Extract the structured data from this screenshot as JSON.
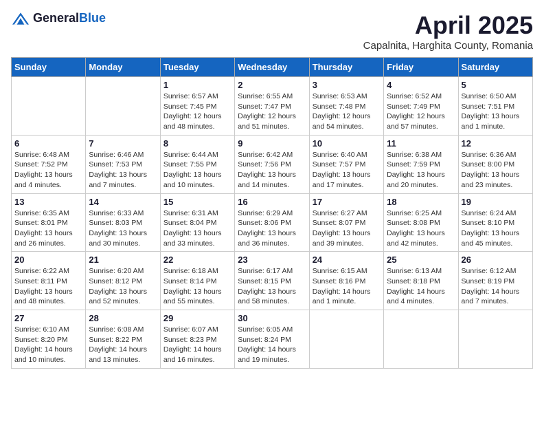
{
  "header": {
    "logo_general": "General",
    "logo_blue": "Blue",
    "title": "April 2025",
    "subtitle": "Capalnita, Harghita County, Romania"
  },
  "days_of_week": [
    "Sunday",
    "Monday",
    "Tuesday",
    "Wednesday",
    "Thursday",
    "Friday",
    "Saturday"
  ],
  "weeks": [
    [
      {
        "day": "",
        "info": ""
      },
      {
        "day": "",
        "info": ""
      },
      {
        "day": "1",
        "info": "Sunrise: 6:57 AM\nSunset: 7:45 PM\nDaylight: 12 hours and 48 minutes."
      },
      {
        "day": "2",
        "info": "Sunrise: 6:55 AM\nSunset: 7:47 PM\nDaylight: 12 hours and 51 minutes."
      },
      {
        "day": "3",
        "info": "Sunrise: 6:53 AM\nSunset: 7:48 PM\nDaylight: 12 hours and 54 minutes."
      },
      {
        "day": "4",
        "info": "Sunrise: 6:52 AM\nSunset: 7:49 PM\nDaylight: 12 hours and 57 minutes."
      },
      {
        "day": "5",
        "info": "Sunrise: 6:50 AM\nSunset: 7:51 PM\nDaylight: 13 hours and 1 minute."
      }
    ],
    [
      {
        "day": "6",
        "info": "Sunrise: 6:48 AM\nSunset: 7:52 PM\nDaylight: 13 hours and 4 minutes."
      },
      {
        "day": "7",
        "info": "Sunrise: 6:46 AM\nSunset: 7:53 PM\nDaylight: 13 hours and 7 minutes."
      },
      {
        "day": "8",
        "info": "Sunrise: 6:44 AM\nSunset: 7:55 PM\nDaylight: 13 hours and 10 minutes."
      },
      {
        "day": "9",
        "info": "Sunrise: 6:42 AM\nSunset: 7:56 PM\nDaylight: 13 hours and 14 minutes."
      },
      {
        "day": "10",
        "info": "Sunrise: 6:40 AM\nSunset: 7:57 PM\nDaylight: 13 hours and 17 minutes."
      },
      {
        "day": "11",
        "info": "Sunrise: 6:38 AM\nSunset: 7:59 PM\nDaylight: 13 hours and 20 minutes."
      },
      {
        "day": "12",
        "info": "Sunrise: 6:36 AM\nSunset: 8:00 PM\nDaylight: 13 hours and 23 minutes."
      }
    ],
    [
      {
        "day": "13",
        "info": "Sunrise: 6:35 AM\nSunset: 8:01 PM\nDaylight: 13 hours and 26 minutes."
      },
      {
        "day": "14",
        "info": "Sunrise: 6:33 AM\nSunset: 8:03 PM\nDaylight: 13 hours and 30 minutes."
      },
      {
        "day": "15",
        "info": "Sunrise: 6:31 AM\nSunset: 8:04 PM\nDaylight: 13 hours and 33 minutes."
      },
      {
        "day": "16",
        "info": "Sunrise: 6:29 AM\nSunset: 8:06 PM\nDaylight: 13 hours and 36 minutes."
      },
      {
        "day": "17",
        "info": "Sunrise: 6:27 AM\nSunset: 8:07 PM\nDaylight: 13 hours and 39 minutes."
      },
      {
        "day": "18",
        "info": "Sunrise: 6:25 AM\nSunset: 8:08 PM\nDaylight: 13 hours and 42 minutes."
      },
      {
        "day": "19",
        "info": "Sunrise: 6:24 AM\nSunset: 8:10 PM\nDaylight: 13 hours and 45 minutes."
      }
    ],
    [
      {
        "day": "20",
        "info": "Sunrise: 6:22 AM\nSunset: 8:11 PM\nDaylight: 13 hours and 48 minutes."
      },
      {
        "day": "21",
        "info": "Sunrise: 6:20 AM\nSunset: 8:12 PM\nDaylight: 13 hours and 52 minutes."
      },
      {
        "day": "22",
        "info": "Sunrise: 6:18 AM\nSunset: 8:14 PM\nDaylight: 13 hours and 55 minutes."
      },
      {
        "day": "23",
        "info": "Sunrise: 6:17 AM\nSunset: 8:15 PM\nDaylight: 13 hours and 58 minutes."
      },
      {
        "day": "24",
        "info": "Sunrise: 6:15 AM\nSunset: 8:16 PM\nDaylight: 14 hours and 1 minute."
      },
      {
        "day": "25",
        "info": "Sunrise: 6:13 AM\nSunset: 8:18 PM\nDaylight: 14 hours and 4 minutes."
      },
      {
        "day": "26",
        "info": "Sunrise: 6:12 AM\nSunset: 8:19 PM\nDaylight: 14 hours and 7 minutes."
      }
    ],
    [
      {
        "day": "27",
        "info": "Sunrise: 6:10 AM\nSunset: 8:20 PM\nDaylight: 14 hours and 10 minutes."
      },
      {
        "day": "28",
        "info": "Sunrise: 6:08 AM\nSunset: 8:22 PM\nDaylight: 14 hours and 13 minutes."
      },
      {
        "day": "29",
        "info": "Sunrise: 6:07 AM\nSunset: 8:23 PM\nDaylight: 14 hours and 16 minutes."
      },
      {
        "day": "30",
        "info": "Sunrise: 6:05 AM\nSunset: 8:24 PM\nDaylight: 14 hours and 19 minutes."
      },
      {
        "day": "",
        "info": ""
      },
      {
        "day": "",
        "info": ""
      },
      {
        "day": "",
        "info": ""
      }
    ]
  ]
}
